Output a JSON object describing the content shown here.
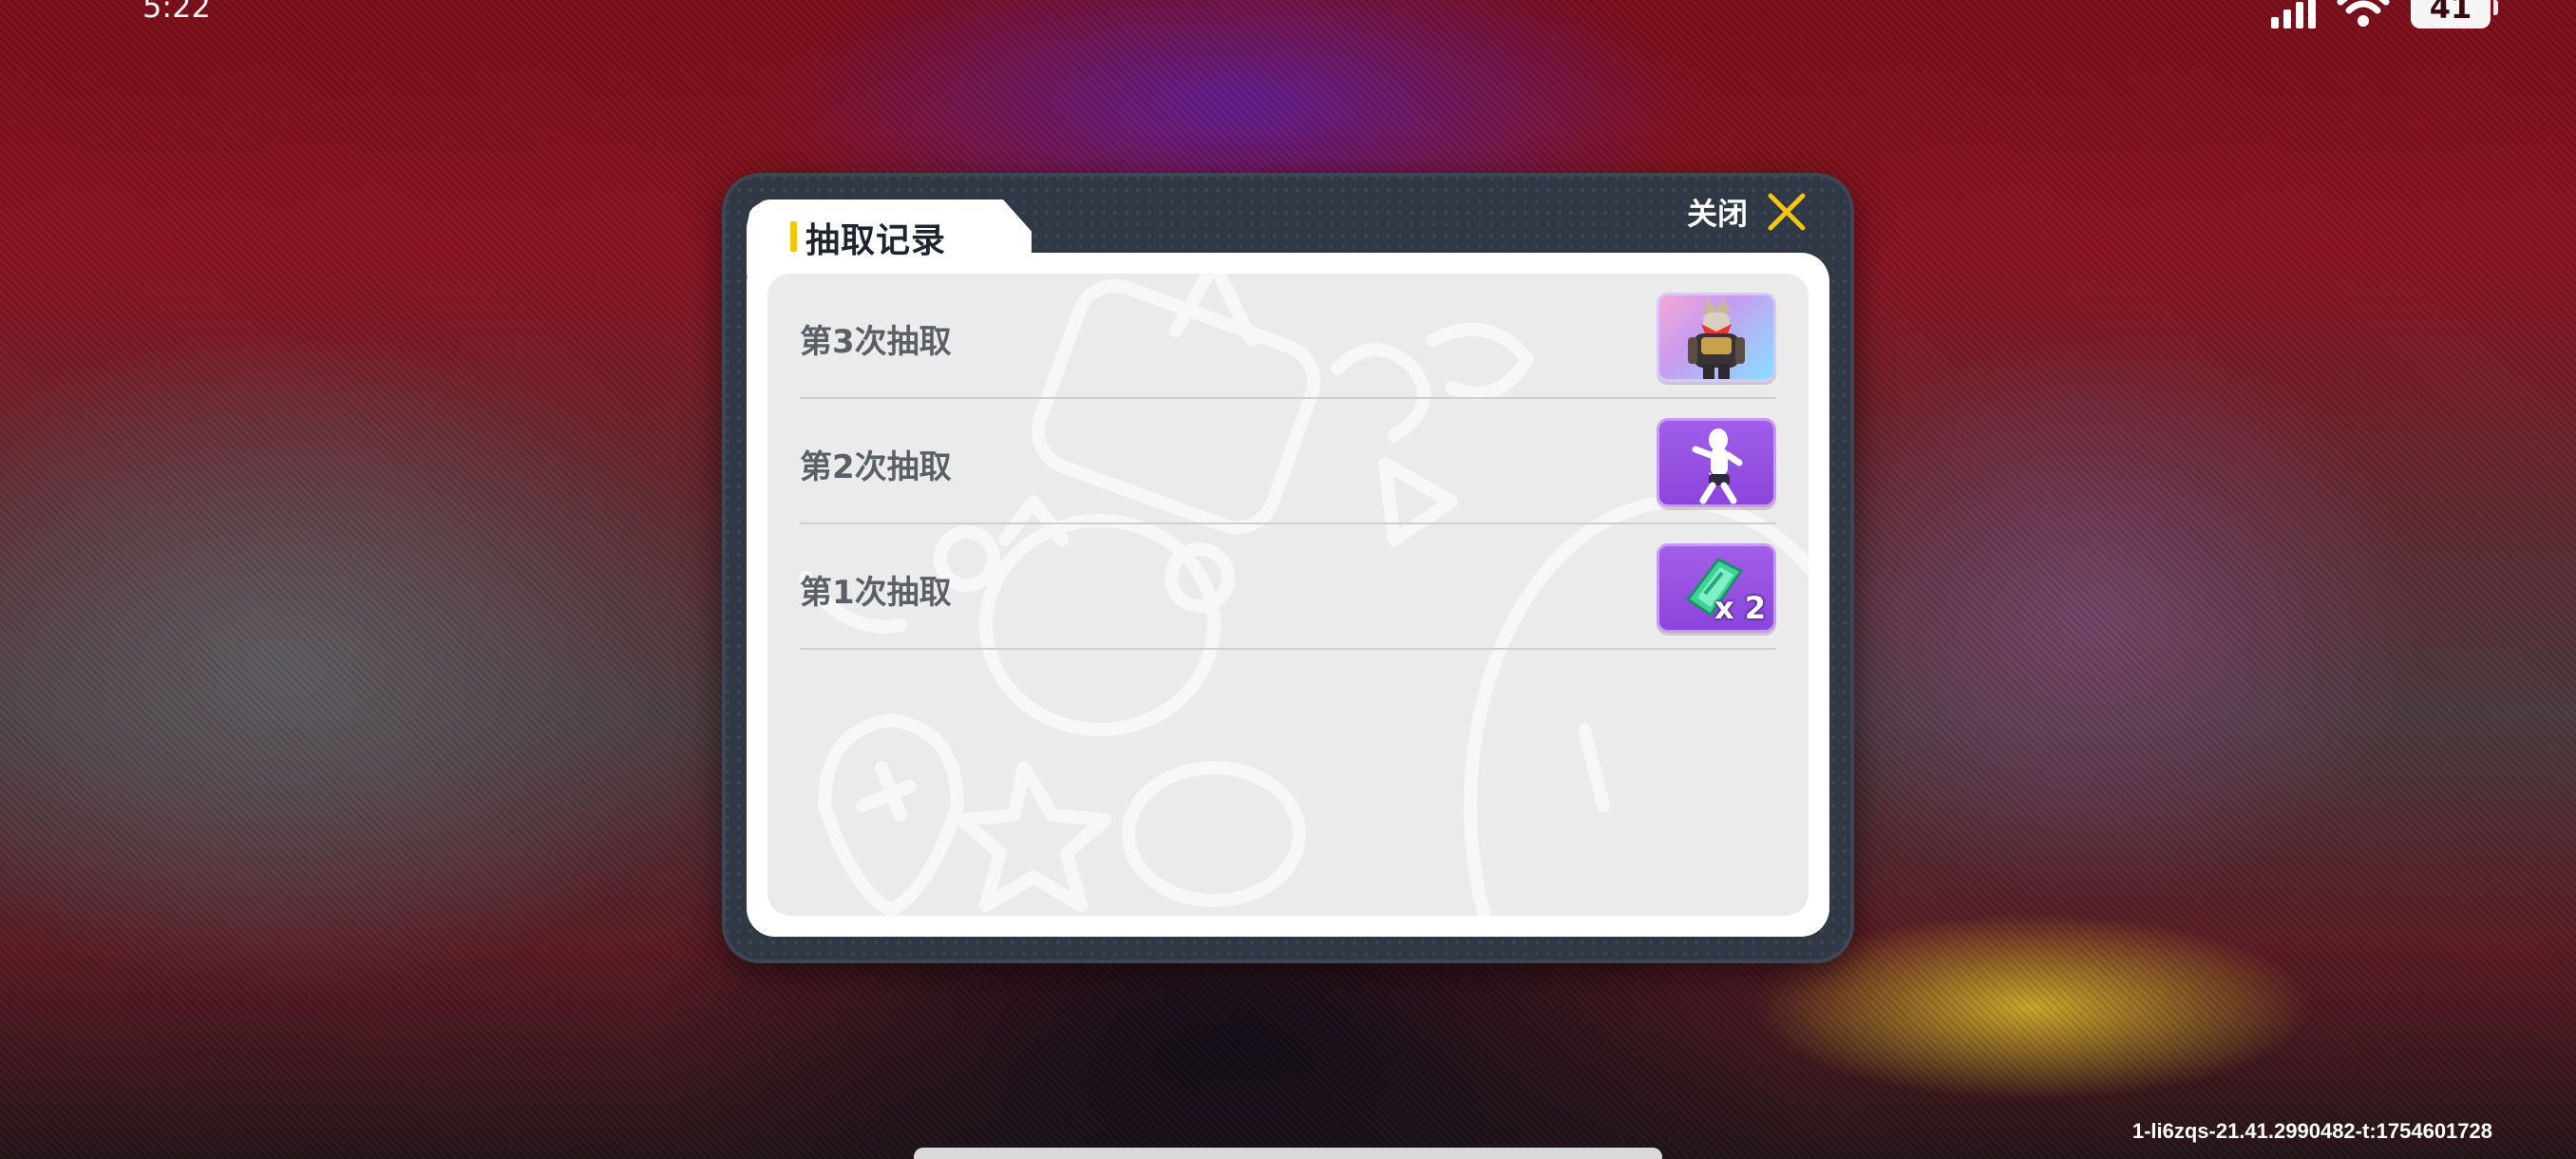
{
  "status_bar": {
    "time": "5:22",
    "battery": "41"
  },
  "dialog": {
    "title": "抽取记录",
    "close_label": "关闭",
    "records": [
      {
        "label": "第3次抽取",
        "reward_icon": "armored-hero-figure-icon",
        "reward_style": "orange",
        "quantity": ""
      },
      {
        "label": "第2次抽取",
        "reward_icon": "white-dancing-figure-icon",
        "reward_style": "purple",
        "quantity": ""
      },
      {
        "label": "第1次抽取",
        "reward_icon": "green-ticket-icon",
        "reward_style": "purple",
        "quantity": "x 2"
      }
    ]
  },
  "footer": {
    "build_id": "1-li6zqs-21.41.2990482-t:1754601728"
  }
}
